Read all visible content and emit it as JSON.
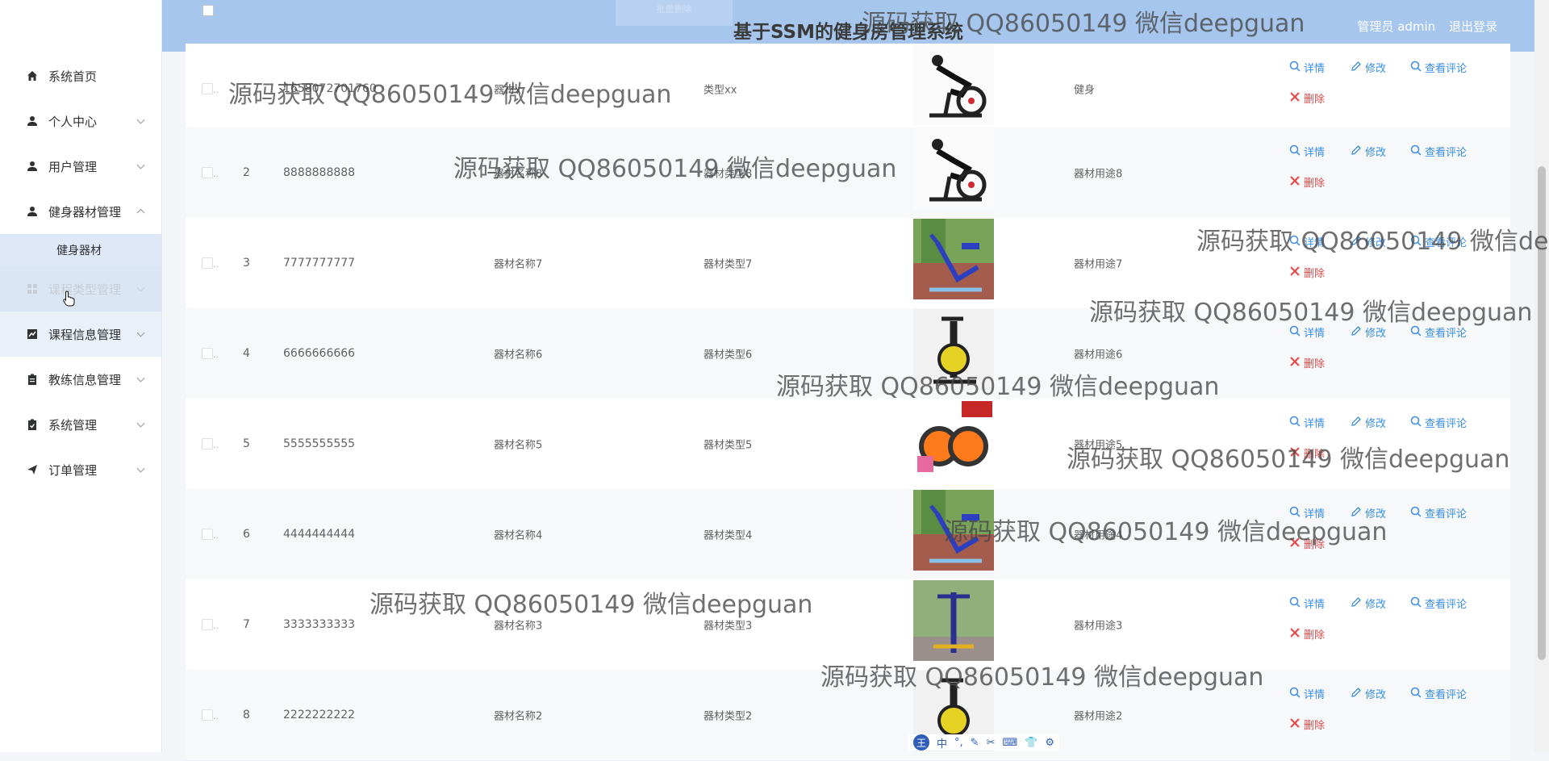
{
  "app": {
    "title": "基于SSM的健身房管理系统",
    "user_role_name": "管理员 admin",
    "logout": "退出登录",
    "ghost_button": "批量删除"
  },
  "sidebar": {
    "items": [
      {
        "label": "系统首页",
        "icon": "home-icon"
      },
      {
        "label": "个人中心",
        "icon": "user-icon"
      },
      {
        "label": "用户管理",
        "icon": "user-icon"
      },
      {
        "label": "健身器材管理",
        "icon": "user-icon",
        "expanded": true
      },
      {
        "label": "健身器材",
        "sub": true
      },
      {
        "label": "课程信息管理",
        "icon": "chart-icon"
      },
      {
        "label": "教练信息管理",
        "icon": "clipboard-icon"
      },
      {
        "label": "系统管理",
        "icon": "settings-icon"
      },
      {
        "label": "订单管理",
        "icon": "send-icon"
      }
    ],
    "hovered_label": "课程类型管理"
  },
  "actions": {
    "detail": "详情",
    "edit": "修改",
    "comments": "查看评论",
    "delete": "删除"
  },
  "rows": [
    {
      "index": "",
      "number": "1658072701760",
      "name": "器材x",
      "type": "类型xx",
      "use": "健身"
    },
    {
      "index": "2",
      "number": "8888888888",
      "name": "器材名称8",
      "type": "器材类型8",
      "use": "器材用途8"
    },
    {
      "index": "3",
      "number": "7777777777",
      "name": "器材名称7",
      "type": "器材类型7",
      "use": "器材用途7"
    },
    {
      "index": "4",
      "number": "6666666666",
      "name": "器材名称6",
      "type": "器材类型6",
      "use": "器材用途6"
    },
    {
      "index": "5",
      "number": "5555555555",
      "name": "器材名称5",
      "type": "器材类型5",
      "use": "器材用途5"
    },
    {
      "index": "6",
      "number": "4444444444",
      "name": "器材名称4",
      "type": "器材类型4",
      "use": "器材用途4"
    },
    {
      "index": "7",
      "number": "3333333333",
      "name": "器材名称3",
      "type": "器材类型3",
      "use": "器材用途3"
    },
    {
      "index": "8",
      "number": "2222222222",
      "name": "器材名称2",
      "type": "器材类型2",
      "use": "器材用途2"
    }
  ],
  "watermark": "源码获取 QQ86050149 微信deepguan",
  "ime": {
    "logo": "王",
    "chinese": "中"
  },
  "colors": {
    "header": "#a6c6ee",
    "link": "#3a8ee6",
    "danger": "#e04b4b"
  }
}
